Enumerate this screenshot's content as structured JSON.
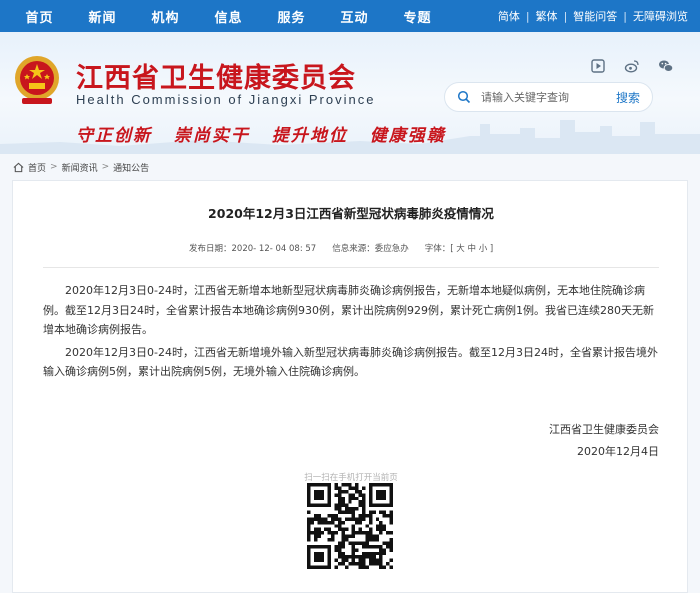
{
  "nav": {
    "items": [
      "首页",
      "新闻",
      "机构",
      "信息",
      "服务",
      "互动",
      "专题"
    ],
    "tools": [
      "简体",
      "繁体",
      "智能问答",
      "无障碍浏览"
    ]
  },
  "header": {
    "title": "江西省卫生健康委员会",
    "subtitle": "Health Commission of Jiangxi Province",
    "slogan": [
      "守正创新",
      "崇尚实干",
      "提升地位",
      "健康强赣"
    ],
    "search_placeholder": "请输入关键字查询",
    "search_button": "搜索",
    "icons": [
      "video-icon",
      "weibo-icon",
      "wechat-icon"
    ]
  },
  "breadcrumb": {
    "home": "首页",
    "items": [
      "新闻资讯",
      "通知公告"
    ],
    "separator": ">"
  },
  "article": {
    "title": "2020年12月3日江西省新型冠状病毒肺炎疫情情况",
    "publish_label": "发布日期：",
    "publish_date": "2020- 12- 04 08: 57",
    "source_label": "信息来源：",
    "source": "委应急办",
    "fontsize_label": "字体：",
    "fontsize_options": "[ 大 中 小 ]",
    "paragraphs": [
      "2020年12月3日0-24时，江西省无新增本地新型冠状病毒肺炎确诊病例报告，无新增本地疑似病例，无本地住院确诊病例。截至12月3日24时，全省累计报告本地确诊病例930例，累计出院病例929例，累计死亡病例1例。我省已连续280天无新增本地确诊病例报告。",
      "2020年12月3日0-24时，江西省无新增境外输入新型冠状病毒肺炎确诊病例报告。截至12月3日24时，全省累计报告境外输入确诊病例5例，累计出院病例5例，无境外输入住院确诊病例。"
    ],
    "signature_org": "江西省卫生健康委员会",
    "signature_date": "2020年12月4日",
    "qr_caption": "扫一扫在手机打开当前页"
  },
  "colors": {
    "nav_blue": "#1d76c7",
    "title_red": "#c8161d"
  }
}
